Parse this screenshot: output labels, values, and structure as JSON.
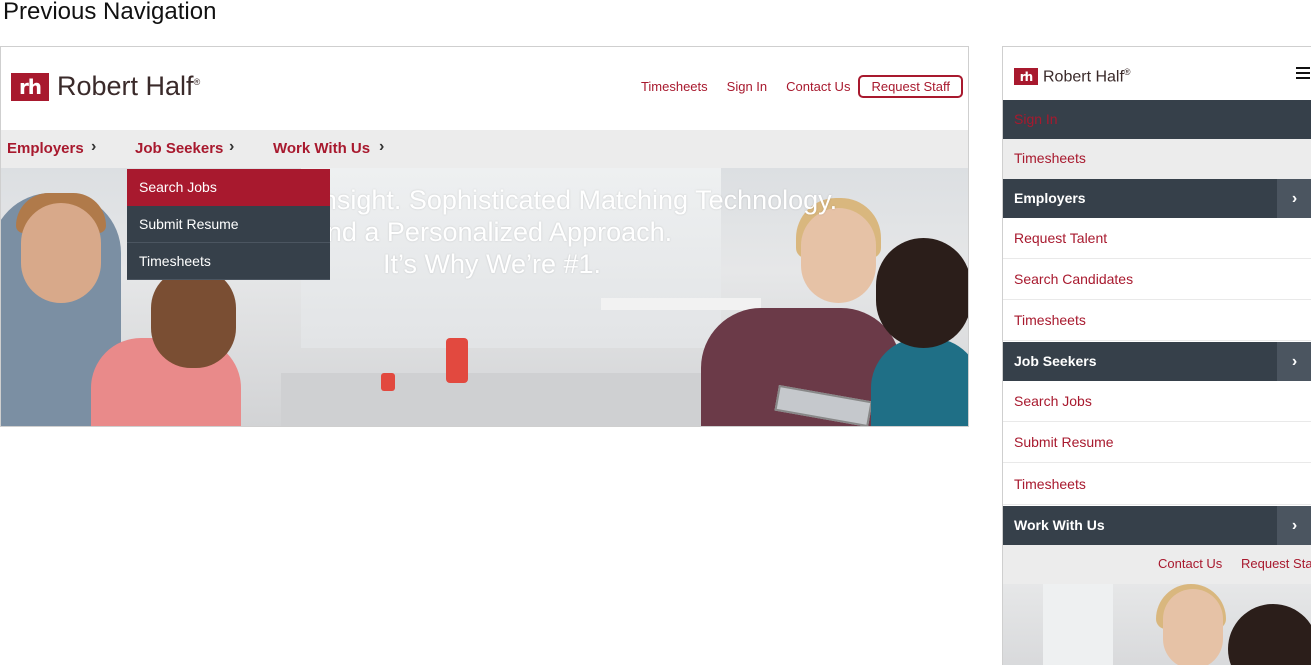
{
  "page": {
    "title": "Previous Navigation"
  },
  "brand": {
    "name": "Robert Half",
    "mark": "rh",
    "registered": "®",
    "color": "#a8192e"
  },
  "desktop": {
    "utility_nav": {
      "timesheets": "Timesheets",
      "sign_in": "Sign In",
      "contact_us": "Contact Us",
      "request_staff": "Request Staff"
    },
    "main_nav": [
      {
        "label": "Employers",
        "chevron": "›"
      },
      {
        "label": "Job Seekers",
        "chevron": "›"
      },
      {
        "label": "Work With Us",
        "chevron": "›"
      }
    ],
    "dropdown": [
      "Search Jobs",
      "Submit Resume",
      "Timesheets"
    ],
    "hero": {
      "line1": "U        y Insight. Sophisticated Matching Technology.",
      "line2": "nd a Personalized Approach.",
      "line3": "It’s Why We’re #1."
    }
  },
  "mobile": {
    "sign_in": "Sign In",
    "timesheets": "Timesheets",
    "sections": [
      {
        "label": "Employers",
        "chevron": "›",
        "links": [
          "Request Talent",
          "Search Candidates",
          "Timesheets"
        ]
      },
      {
        "label": "Job Seekers",
        "chevron": "›",
        "links": [
          "Search Jobs",
          "Submit Resume",
          "Timesheets"
        ]
      },
      {
        "label": "Work With Us",
        "chevron": "›"
      }
    ],
    "utility": {
      "contact_us": "Contact Us",
      "request_staff": "Request Staff"
    }
  },
  "colors": {
    "accent": "#a8192e",
    "dark_nav": "#36404a",
    "light_nav": "#ececec"
  },
  "icons": {
    "chevron": "chevron-right-icon",
    "menu": "hamburger-menu-icon"
  }
}
